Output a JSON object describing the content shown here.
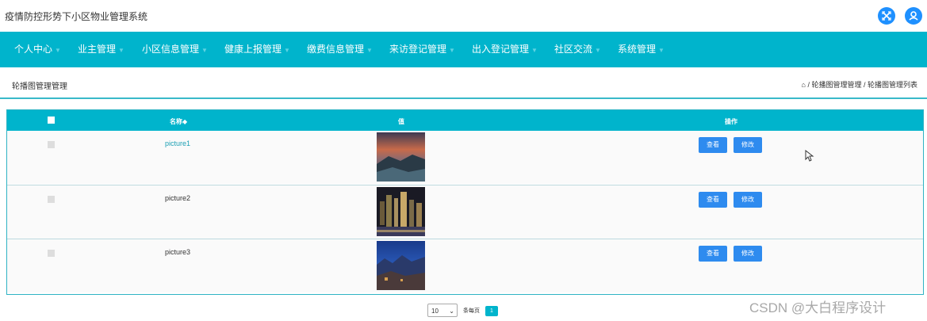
{
  "app": {
    "title": "疫情防控形势下小区物业管理系统"
  },
  "header_icons": [
    {
      "name": "fullscreen-icon",
      "glyph": "⤢"
    },
    {
      "name": "user-icon",
      "glyph": "⍝"
    }
  ],
  "nav": {
    "items": [
      {
        "label": "个人中心"
      },
      {
        "label": "业主管理"
      },
      {
        "label": "小区信息管理"
      },
      {
        "label": "健康上报管理"
      },
      {
        "label": "缴费信息管理"
      },
      {
        "label": "来访登记管理"
      },
      {
        "label": "出入登记管理"
      },
      {
        "label": "社区交流"
      },
      {
        "label": "系统管理"
      }
    ]
  },
  "breadcrumb": {
    "title": "轮播图管理管理",
    "home_icon": "⌂",
    "path": "/ 轮播图管理管理 / 轮播图管理列表"
  },
  "table": {
    "headers": {
      "name": "名称◆",
      "value": "值",
      "actions": "操作"
    },
    "rows": [
      {
        "name": "picture1",
        "view_label": "查看",
        "edit_label": "修改"
      },
      {
        "name": "picture2",
        "view_label": "查看",
        "edit_label": "修改"
      },
      {
        "name": "picture3",
        "view_label": "查看",
        "edit_label": "修改"
      }
    ]
  },
  "pagination": {
    "page_size": "10",
    "dropdown_glyph": "⌄",
    "per_page_label": "条每页",
    "current_page": "1"
  },
  "watermark": "CSDN @大白程序设计",
  "colors": {
    "accent": "#00b4cc",
    "button": "#2e8bef",
    "link": "#1ea0b4"
  }
}
